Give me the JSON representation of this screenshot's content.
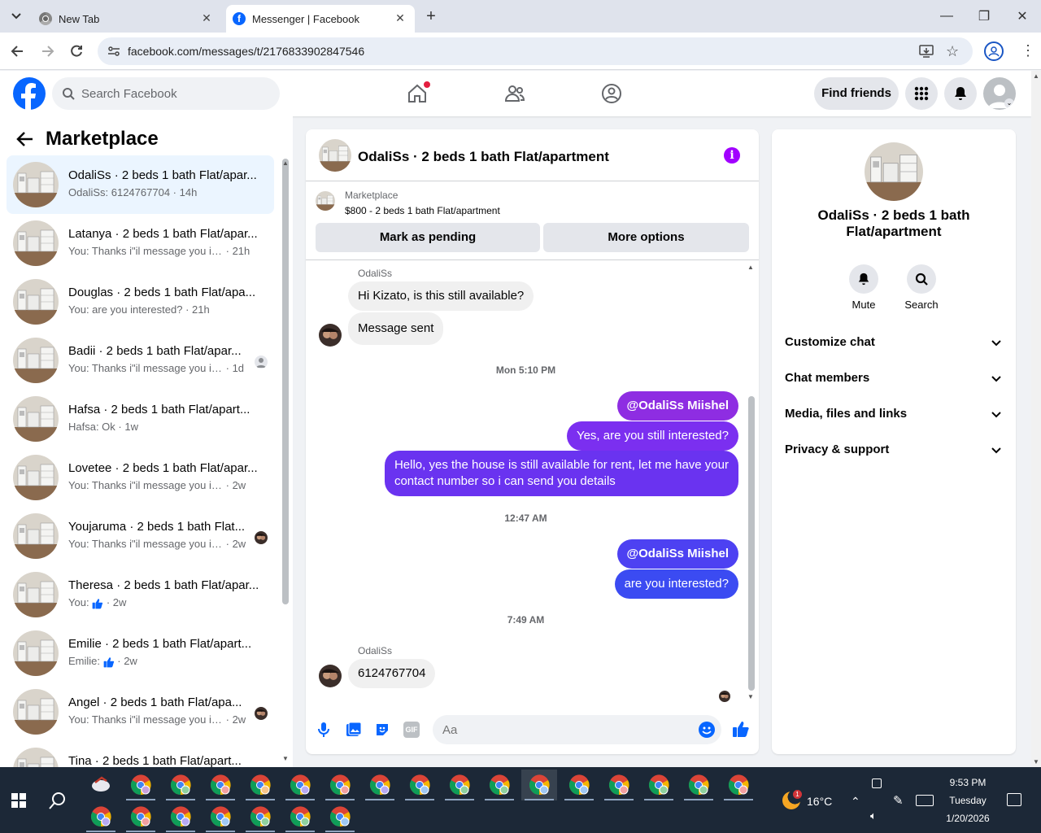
{
  "browser": {
    "tabs": [
      {
        "title": "New Tab",
        "icon": "chrome-icon"
      },
      {
        "title": "Messenger | Facebook",
        "icon": "facebook-icon"
      }
    ],
    "url": "facebook.com/messages/t/2176833902847546"
  },
  "fb": {
    "search_placeholder": "Search Facebook",
    "find_friends": "Find friends"
  },
  "sidebar": {
    "title": "Marketplace",
    "conversations": [
      {
        "name": "OdaliSs · 2 beds 1 bath Flat/apar...",
        "msg": "OdaliSs: 6124767704",
        "time": "· 14h"
      },
      {
        "name": "Latanya · 2 beds 1 bath Flat/apar...",
        "msg": "You: Thanks i\"il message you in a ...",
        "time": "· 21h"
      },
      {
        "name": "Douglas · 2 beds 1 bath Flat/apa...",
        "msg": "You: are you interested?",
        "time": "· 21h"
      },
      {
        "name": "Badii · 2 beds 1 bath Flat/apar...",
        "msg": "You: Thanks i\"il message you in ...",
        "time": "· 1d"
      },
      {
        "name": "Hafsa · 2 beds 1 bath Flat/apart...",
        "msg": "Hafsa: Ok",
        "time": "· 1w"
      },
      {
        "name": "Lovetee · 2 beds 1 bath Flat/apar...",
        "msg": "You: Thanks i\"il message you in a ...",
        "time": "· 2w"
      },
      {
        "name": "Youjaruma · 2 beds 1 bath Flat...",
        "msg": "You: Thanks i\"il message you in ...",
        "time": "· 2w"
      },
      {
        "name": "Theresa · 2 beds 1 bath Flat/apar...",
        "msg": "You:",
        "time": "· 2w"
      },
      {
        "name": "Emilie · 2 beds 1 bath Flat/apart...",
        "msg": "Emilie:",
        "time": "· 2w"
      },
      {
        "name": "Angel · 2 beds 1 bath Flat/apa...",
        "msg": "You: Thanks i\"il message you in ...",
        "time": "· 2w"
      },
      {
        "name": "Tina · 2 beds 1 bath Flat/apart...",
        "msg": "",
        "time": ""
      }
    ]
  },
  "chat": {
    "title": "OdaliSs · 2 beds 1 bath Flat/apartment",
    "marketplace_label": "Marketplace",
    "listing": "$800 - 2 beds 1 bath Flat/apartment",
    "mark_pending": "Mark as pending",
    "more_options": "More options",
    "sender": "OdaliSs",
    "msg1": "Hi Kizato, is this still available?",
    "msg2": "Message sent",
    "stamp1": "Mon 5:10 PM",
    "out1": "@OdaliSs Miishel",
    "out2": "Yes, are you still interested?",
    "out3a": "Hello, yes the house is still available for rent, let me have your",
    "out3b": "contact number so i can send you details",
    "stamp2": "12:47 AM",
    "out4": "@OdaliSs Miishel",
    "out5": "are you interested?",
    "stamp3": "7:49 AM",
    "msg3": "6124767704",
    "composer_placeholder": "Aa",
    "colors": {
      "purple": "#8e2de2",
      "violet": "#6a33f0",
      "blue": "#3b4bf2",
      "accent": "#0866ff"
    }
  },
  "info": {
    "title": "OdaliSs · 2 beds 1 bath Flat/apartment",
    "mute": "Mute",
    "search": "Search",
    "rows": [
      "Customize chat",
      "Chat members",
      "Media, files and links",
      "Privacy & support"
    ]
  },
  "taskbar": {
    "weather": "16°C",
    "time": "9:53 PM",
    "day": "Tuesday",
    "date": "1/20/2026",
    "badge": "1"
  }
}
